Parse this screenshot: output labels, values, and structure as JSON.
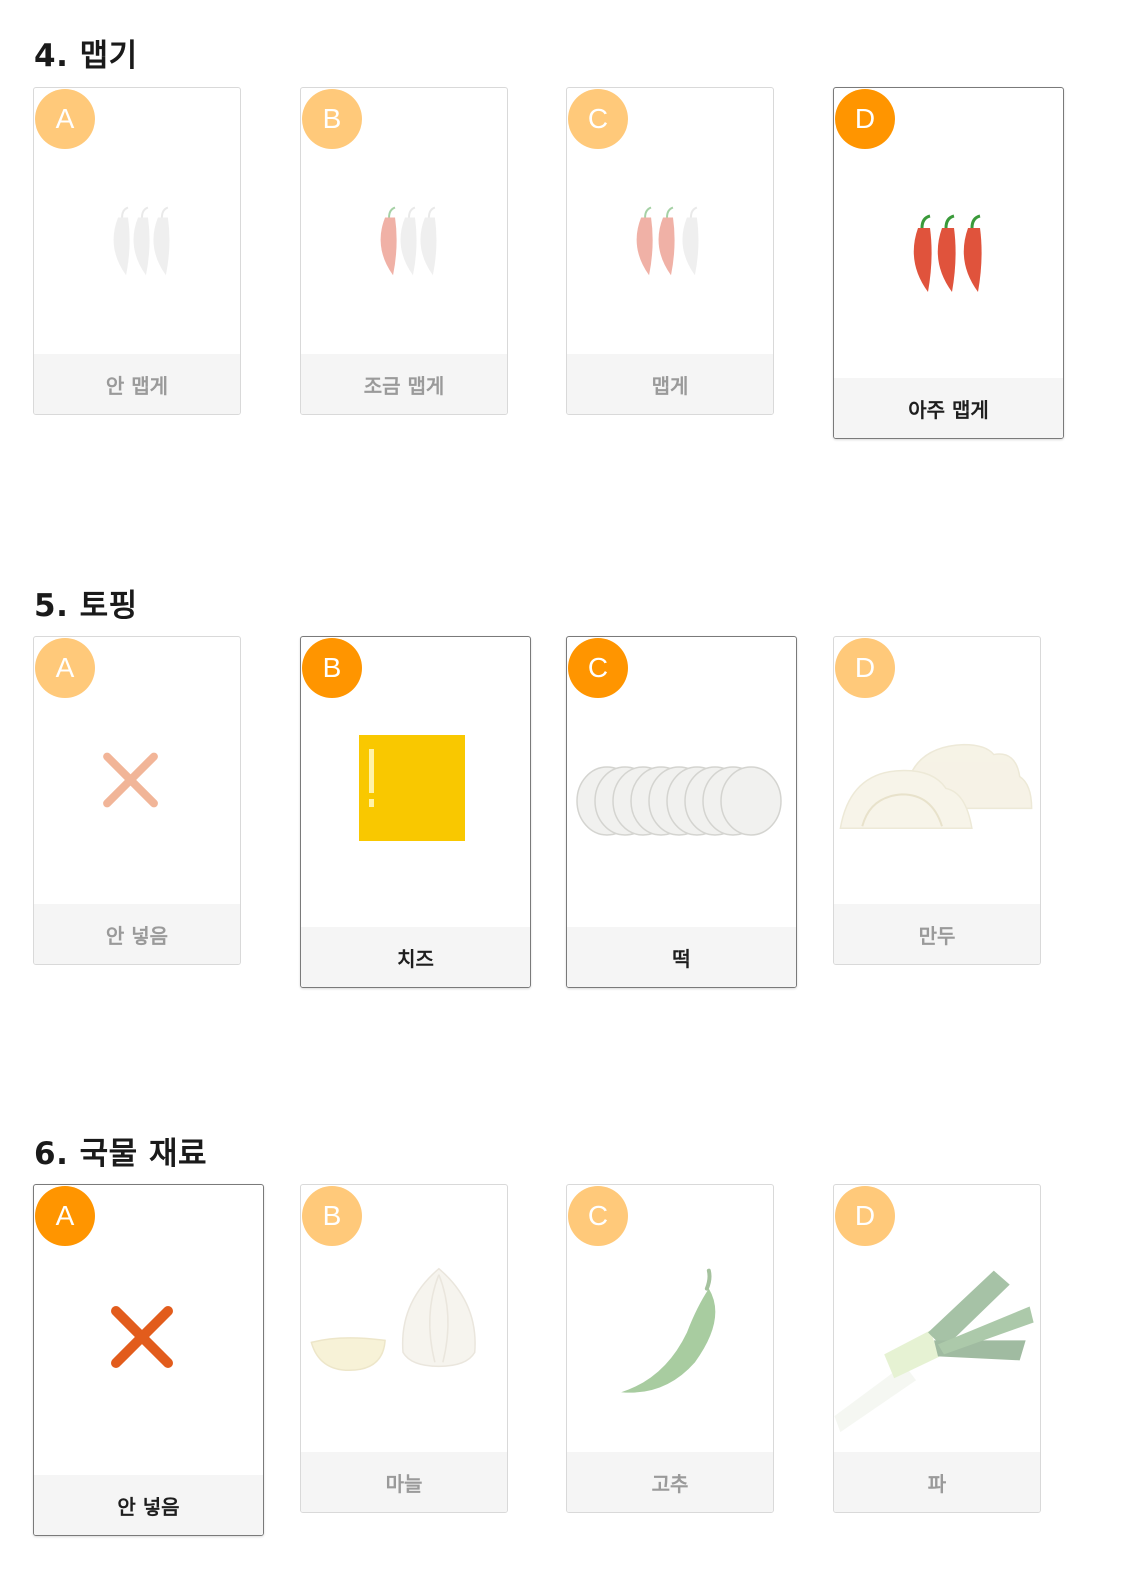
{
  "sections": [
    {
      "title": "4. 맵기",
      "options": [
        {
          "letter": "A",
          "label": "안 맵게",
          "selected": false,
          "icon": "pepper-none-icon"
        },
        {
          "letter": "B",
          "label": "조금 맵게",
          "selected": false,
          "icon": "pepper-one-icon"
        },
        {
          "letter": "C",
          "label": "맵게",
          "selected": false,
          "icon": "pepper-two-icon"
        },
        {
          "letter": "D",
          "label": "아주 맵게",
          "selected": true,
          "icon": "pepper-three-icon"
        }
      ]
    },
    {
      "title": "5. 토핑",
      "options": [
        {
          "letter": "A",
          "label": "안 넣음",
          "selected": false,
          "icon": "x-mark-icon"
        },
        {
          "letter": "B",
          "label": "치즈",
          "selected": true,
          "icon": "cheese-icon"
        },
        {
          "letter": "C",
          "label": "떡",
          "selected": true,
          "icon": "rice-cake-icon"
        },
        {
          "letter": "D",
          "label": "만두",
          "selected": false,
          "icon": "dumpling-icon"
        }
      ]
    },
    {
      "title": "6. 국물 재료",
      "options": [
        {
          "letter": "A",
          "label": "안 넣음",
          "selected": true,
          "icon": "x-mark-icon"
        },
        {
          "letter": "B",
          "label": "마늘",
          "selected": false,
          "icon": "garlic-icon"
        },
        {
          "letter": "C",
          "label": "고추",
          "selected": false,
          "icon": "green-chili-icon"
        },
        {
          "letter": "D",
          "label": "파",
          "selected": false,
          "icon": "green-onion-icon"
        }
      ]
    }
  ],
  "colors": {
    "badge_selected": "#ff9500",
    "badge_unselected": "#ffc97a",
    "label_background": "#f5f5f5"
  }
}
